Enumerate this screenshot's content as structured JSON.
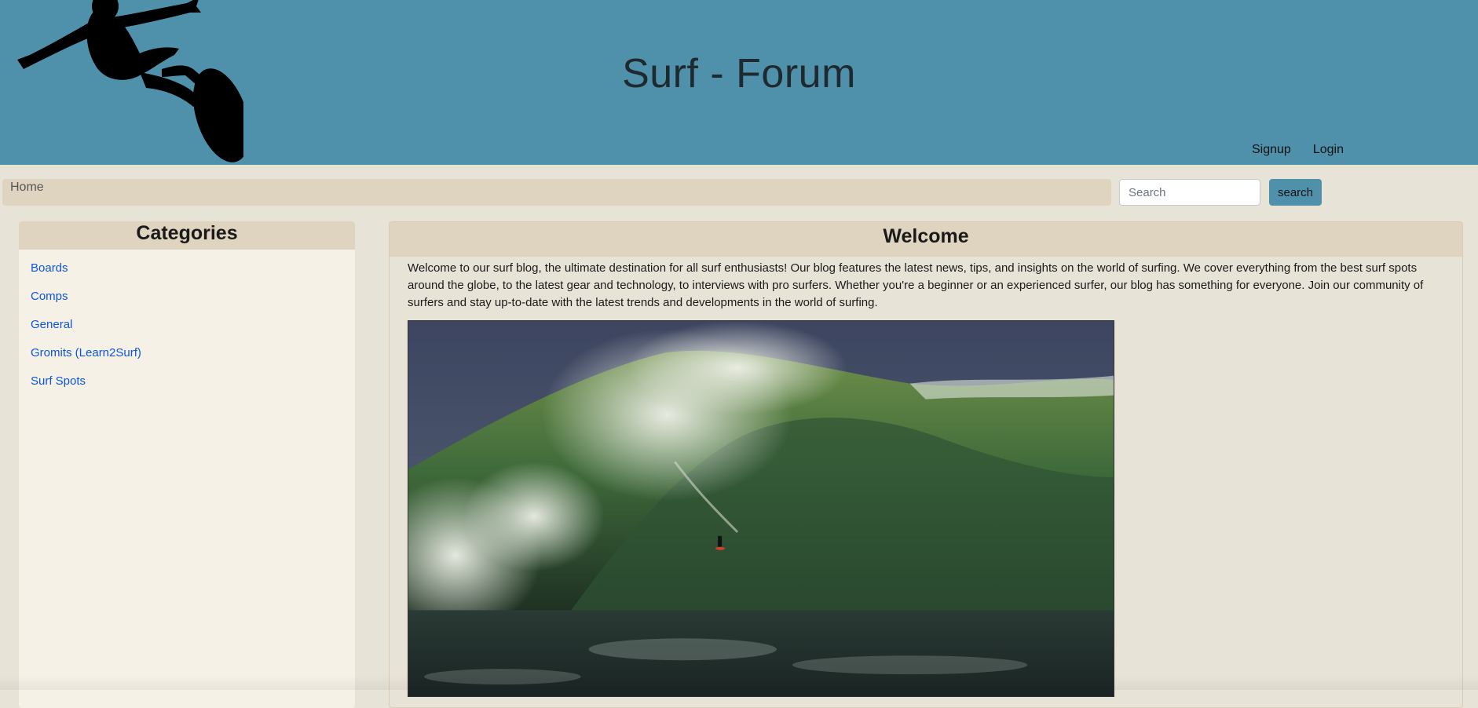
{
  "header": {
    "title": "Surf - Forum",
    "background_color": "#4f91ab",
    "logo_icon": "surfer-silhouette-icon",
    "nav": [
      {
        "label": "Signup"
      },
      {
        "label": "Login"
      }
    ]
  },
  "breadcrumb": {
    "items": [
      "Home"
    ]
  },
  "search": {
    "placeholder": "Search",
    "value": "",
    "button_label": "search"
  },
  "categories": {
    "title": "Categories",
    "items": [
      {
        "label": "Boards"
      },
      {
        "label": "Comps"
      },
      {
        "label": "General"
      },
      {
        "label": "Gromits (Learn2Surf)"
      },
      {
        "label": "Surf Spots"
      }
    ]
  },
  "welcome": {
    "title": "Welcome",
    "text": "Welcome to our surf blog, the ultimate destination for all surf enthusiasts! Our blog features the latest news, tips, and insights on the world of surfing. We cover everything from the best surf spots around the globe, to the latest gear and technology, to interviews with pro surfers. Whether you're a beginner or an experienced surfer, our blog has something for everyone. Join our community of surfers and stay up-to-date with the latest trends and developments in the world of surfing.",
    "image": "big-wave-surfer-photo"
  },
  "colors": {
    "header": "#4f91ab",
    "page_background": "#e8e3d7",
    "panel_header": "#dfd4bf",
    "link": "#0d55d8"
  }
}
